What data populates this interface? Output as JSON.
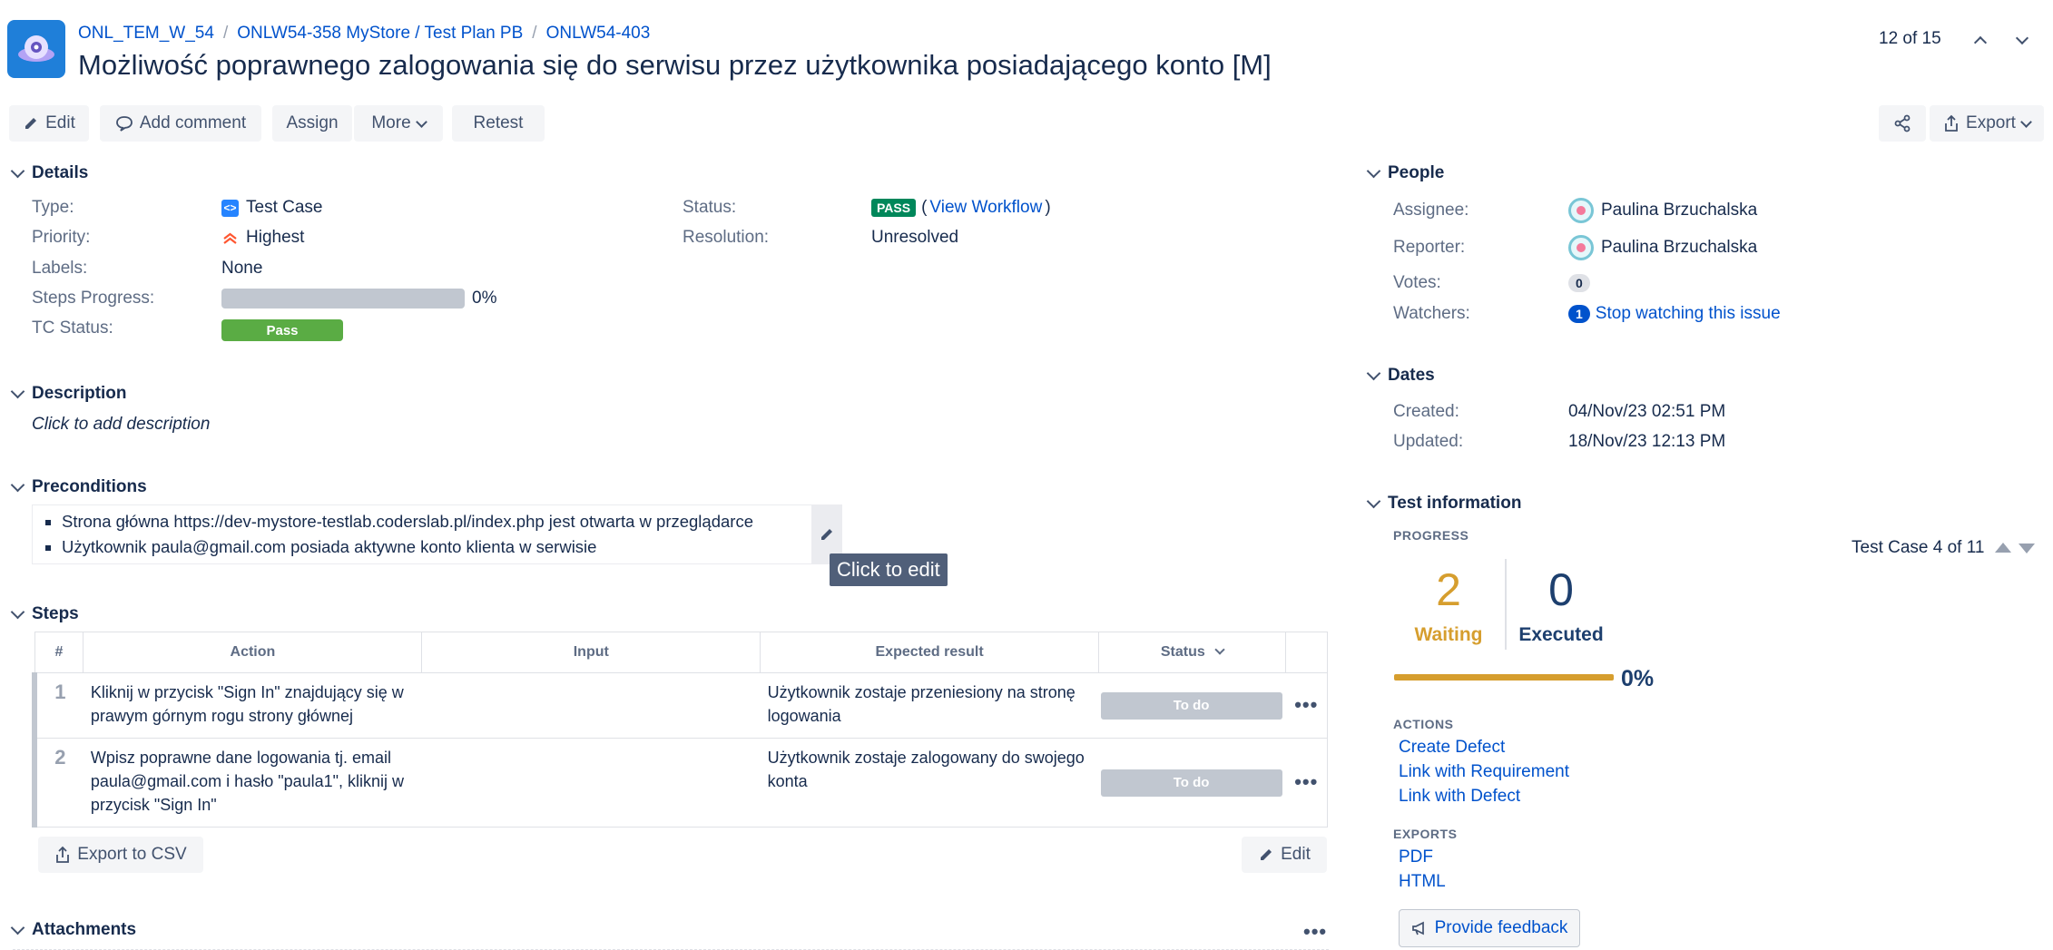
{
  "breadcrumb": {
    "project": "ONL_TEM_W_54",
    "parent": "ONLW54-358 MyStore / Test Plan PB",
    "issue": "ONLW54-403",
    "separator": "/"
  },
  "issue_title": "Możliwość poprawnego zalogowania się do serwisu przez użytkownika posiadającego konto [M]",
  "pager": {
    "text": "12 of 15"
  },
  "toolbar": {
    "edit": "Edit",
    "add_comment": "Add comment",
    "assign": "Assign",
    "more": "More",
    "retest": "Retest",
    "export": "Export"
  },
  "details": {
    "title": "Details",
    "type_label": "Type:",
    "type_value": "Test Case",
    "priority_label": "Priority:",
    "priority_value": "Highest",
    "labels_label": "Labels:",
    "labels_value": "None",
    "steps_progress_label": "Steps Progress:",
    "steps_progress_value": "0%",
    "steps_progress_fraction": 0,
    "tc_status_label": "TC Status:",
    "tc_status_value": "Pass",
    "status_label": "Status:",
    "status_badge": "PASS",
    "view_workflow": "View Workflow",
    "paren_open": "(",
    "paren_close": ")",
    "resolution_label": "Resolution:",
    "resolution_value": "Unresolved"
  },
  "description": {
    "title": "Description",
    "placeholder": "Click to add description"
  },
  "preconditions": {
    "title": "Preconditions",
    "items": [
      "Strona główna https://dev-mystore-testlab.coderslab.pl/index.php jest otwarta w przeglądarce",
      "Użytkownik paula@gmail.com posiada aktywne konto klienta w serwisie"
    ],
    "tooltip": "Click to edit"
  },
  "steps": {
    "title": "Steps",
    "headers": {
      "num": "#",
      "action": "Action",
      "input": "Input",
      "expected": "Expected result",
      "status": "Status"
    },
    "rows": [
      {
        "num": "1",
        "action": "Kliknij w przycisk \"Sign In\" znajdujący się w prawym górnym rogu strony głównej",
        "input": "",
        "expected": "Użytkownik zostaje przeniesiony na stronę logowania",
        "status": "To do"
      },
      {
        "num": "2",
        "action": "Wpisz poprawne dane logowania tj. email paula@gmail.com i hasło \"paula1\", kliknij w przycisk \"Sign In\"",
        "input": "",
        "expected": "Użytkownik zostaje zalogowany do swojego konta",
        "status": "To do"
      }
    ],
    "export_csv": "Export to CSV",
    "edit": "Edit"
  },
  "attachments": {
    "title": "Attachments"
  },
  "people": {
    "title": "People",
    "assignee_label": "Assignee:",
    "assignee": "Paulina Brzuchalska",
    "reporter_label": "Reporter:",
    "reporter": "Paulina Brzuchalska",
    "votes_label": "Votes:",
    "votes": "0",
    "watchers_label": "Watchers:",
    "watchers_count": "1",
    "stop_watching": "Stop watching this issue"
  },
  "dates": {
    "title": "Dates",
    "created_label": "Created:",
    "created": "04/Nov/23 02:51 PM",
    "updated_label": "Updated:",
    "updated": "18/Nov/23 12:13 PM"
  },
  "test_info": {
    "title": "Test information",
    "progress_head": "PROGRESS",
    "test_case_pager": "Test Case 4 of 11",
    "waiting_count": "2",
    "waiting_label": "Waiting",
    "executed_count": "0",
    "executed_label": "Executed",
    "progress_pct": "0%",
    "actions_head": "ACTIONS",
    "actions": [
      "Create Defect",
      "Link with Requirement",
      "Link with Defect"
    ],
    "exports_head": "EXPORTS",
    "exports": [
      "PDF",
      "HTML"
    ],
    "feedback": "Provide feedback"
  },
  "colors": {
    "link": "#0052cc",
    "pass_badge": "#00875a",
    "tc_pass": "#5aac44",
    "waiting": "#d69e2e",
    "executed": "#1d3f6e",
    "todo": "#c1c7d0"
  }
}
